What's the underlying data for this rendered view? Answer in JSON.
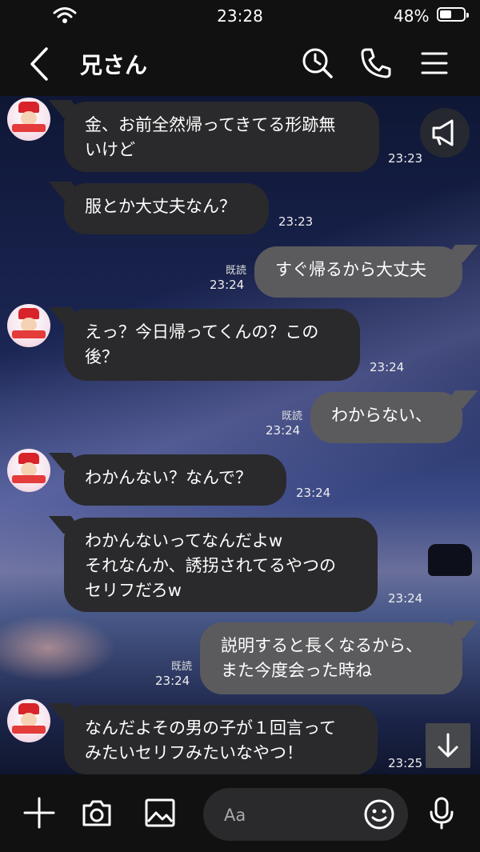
{
  "status_bar": {
    "time": "23:28",
    "battery_percent": "48%",
    "battery_level": 0.48
  },
  "header": {
    "title": "兄さん",
    "icons": [
      "back-icon",
      "search-history-icon",
      "phone-icon",
      "menu-icon"
    ]
  },
  "messages": [
    {
      "from": "other",
      "text": "金、お前全然帰ってきてる形跡無\nいけど",
      "time": "23:23"
    },
    {
      "from": "other",
      "text": "服とか大丈夫なん？",
      "time": "23:23"
    },
    {
      "from": "me",
      "text": "すぐ帰るから大丈夫",
      "read": "既読",
      "time": "23:24"
    },
    {
      "from": "other",
      "text": "えっ？今日帰ってくんの？この\n後？",
      "time": "23:24"
    },
    {
      "from": "me",
      "text": "わからない、",
      "read": "既読",
      "time": "23:24"
    },
    {
      "from": "other",
      "text": "わかんない？なんで？",
      "time": "23:24"
    },
    {
      "from": "other",
      "text": "わかんないってなんだよw\nそれなんか、誘拐されてるやつの\nセリフだろw",
      "time": "23:24"
    },
    {
      "from": "me",
      "text": "説明すると長くなるから、\nまた今度会った時ね",
      "read": "既読",
      "time": "23:24"
    },
    {
      "from": "other",
      "text": "なんだよその男の子が１回言って\nみたいセリフみたいなやつ！",
      "time": "23:25"
    }
  ],
  "composer": {
    "placeholder": "Aa",
    "icons": [
      "plus-icon",
      "camera-icon",
      "image-icon",
      "emoji-icon",
      "microphone-icon"
    ]
  },
  "floating": {
    "announcement": "megaphone-icon",
    "scroll": "arrow-down-icon"
  },
  "colors": {
    "incoming_bubble": "#2a2a2c",
    "outgoing_bubble": "#5b5b5e",
    "bars": "#111111"
  }
}
